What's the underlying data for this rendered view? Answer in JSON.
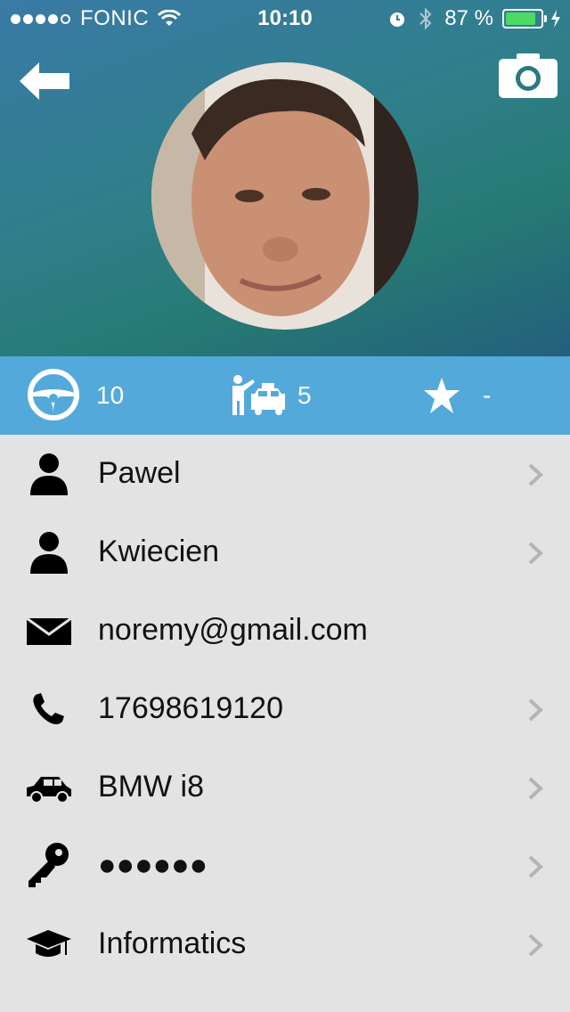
{
  "status_bar": {
    "carrier": "FONIC",
    "time": "10:10",
    "battery": "87 %",
    "battery_level": 0.87
  },
  "header": {
    "back_icon": "arrow-left-icon",
    "camera_icon": "camera-icon"
  },
  "stats": {
    "rides_as_driver": "10",
    "rides_as_passenger": "5",
    "rating": "-"
  },
  "profile": {
    "rows": [
      {
        "icon": "person-icon",
        "label": "Pawel",
        "chevron": true
      },
      {
        "icon": "person-icon",
        "label": "Kwiecien",
        "chevron": true
      },
      {
        "icon": "envelope-icon",
        "label": "noremy@gmail.com",
        "chevron": false
      },
      {
        "icon": "phone-icon",
        "label": "17698619120",
        "chevron": true
      },
      {
        "icon": "car-icon",
        "label": "BMW i8",
        "chevron": true
      },
      {
        "icon": "key-icon",
        "label": "●●●●●●",
        "chevron": true
      },
      {
        "icon": "graduation-cap-icon",
        "label": "Informatics",
        "chevron": true
      }
    ]
  },
  "colors": {
    "stats_bar": "#54a9db",
    "list_background": "#e3e3e3",
    "battery_fill": "#4cd964"
  }
}
